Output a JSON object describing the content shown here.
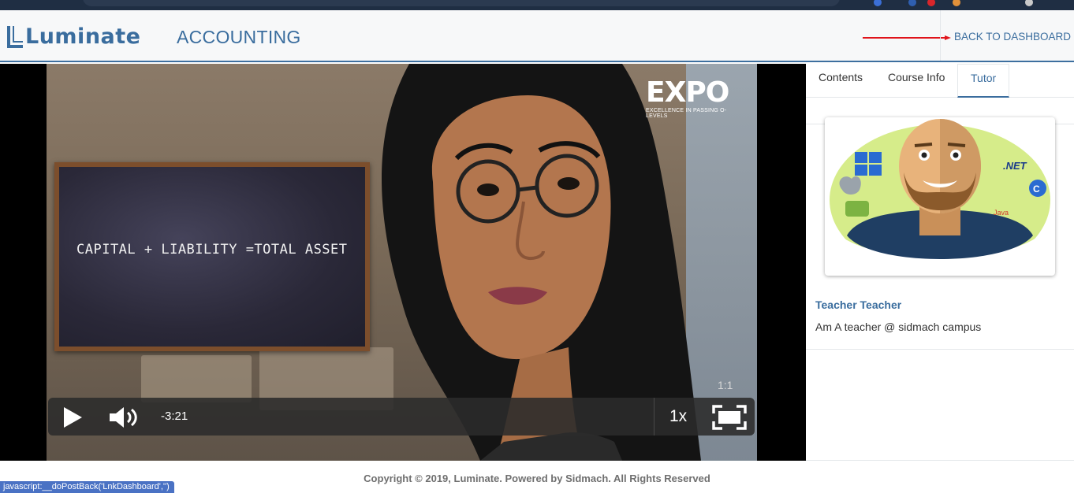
{
  "header": {
    "logo_text": "Luminate",
    "course_title": "ACCOUNTING",
    "back_link": "BACK TO DASHBOARD"
  },
  "video": {
    "chalkboard_text": "CAPITAL + LIABILITY =TOTAL ASSET",
    "watermark_word": "EXPO",
    "watermark_sub": "EXCELLENCE IN PASSING O-LEVELS",
    "time_peek": "1:1",
    "controls": {
      "remaining": "-3:21",
      "speed": "1x"
    }
  },
  "sidebar": {
    "tabs": [
      {
        "label": "Contents",
        "active": false
      },
      {
        "label": "Course Info",
        "active": false
      },
      {
        "label": "Tutor",
        "active": true
      }
    ],
    "tutor": {
      "name": "Teacher Teacher",
      "description": "Am A teacher @ sidmach campus"
    }
  },
  "footer": {
    "copyright": "Copyright © 2019, Luminate. Powered by Sidmach. All Rights Reserved",
    "status_url": "javascript:__doPostBack('LnkDashboard','')"
  },
  "colors": {
    "brand_blue": "#3a6d9e",
    "annotation_red": "#e0141b",
    "status_bar": "#4a72c4"
  }
}
